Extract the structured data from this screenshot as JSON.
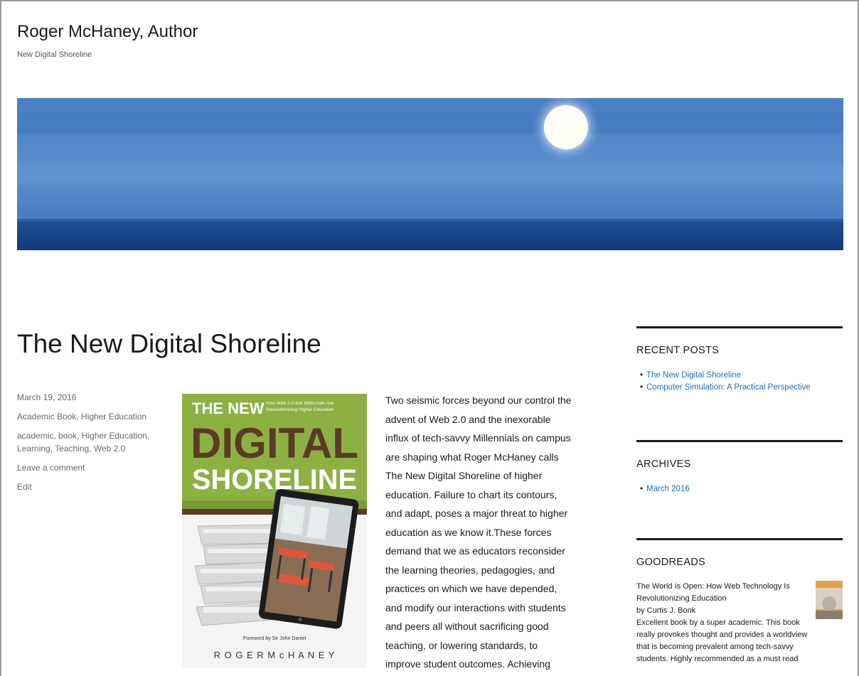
{
  "site": {
    "title": "Roger McHaney, Author",
    "description": "New Digital Shoreline"
  },
  "post": {
    "title": "The New Digital Shoreline",
    "date": "March 19, 2016",
    "categories": "Academic Book, Higher Education",
    "tags": "academic, book, Higher Education, Learning, Teaching, Web 2.0",
    "comment_link": "Leave a comment",
    "edit_link": "Edit",
    "body_lines": [
      "Two seismic forces beyond our control the",
      "advent of Web 2.0 and the inexorable",
      "influx of tech-savvy Millennials on campus",
      "are shaping what Roger McHaney calls",
      "The New Digital Shoreline of higher",
      "education. Failure to chart its contours,",
      "and adapt, poses a major threat to higher",
      "education as we know it.These forces",
      "demand that we as educators reconsider",
      "the learning theories, pedagogies, and",
      "practices on which we have depended,",
      "and modify our interactions with students",
      "and peers all without sacrificing good",
      "teaching, or lowering standards, to",
      "improve student outcomes. Achieving"
    ]
  },
  "book_cover": {
    "line1": "THE NEW",
    "subtitle_line1": "How Web 2.0 and Millennials Are",
    "subtitle_line2": "Revolutionizing Higher Education",
    "line2": "DIGITAL",
    "line3": "SHORELINE",
    "foreword": "Foreword by Sir John Daniel",
    "author": "R O G E R   M c H A N E Y"
  },
  "sidebar": {
    "recent_posts": {
      "title": "RECENT POSTS",
      "items": [
        "The New Digital Shoreline",
        "Computer Simulation: A Practical Perspective"
      ]
    },
    "archives": {
      "title": "ARCHIVES",
      "items": [
        "March 2016"
      ]
    },
    "goodreads": {
      "title": "GOODREADS",
      "book_title_line1": "The World Is Open: How Web Technology Is",
      "book_title_line2": "Revolutionizing Education",
      "author_line": "by Curtis J. Bonk",
      "review_lines": [
        "Excellent book by a super academic. This book",
        "really provokes thought and provides a worldview",
        "that is becoming prevalent among tech-savvy",
        "students. Highly recommended as a must read"
      ]
    }
  },
  "colors": {
    "link": "#1a6fb4",
    "text": "#1a1a1a",
    "meta": "#686868",
    "cover_green": "#8db043",
    "cover_title_brown": "#5b3b26"
  }
}
